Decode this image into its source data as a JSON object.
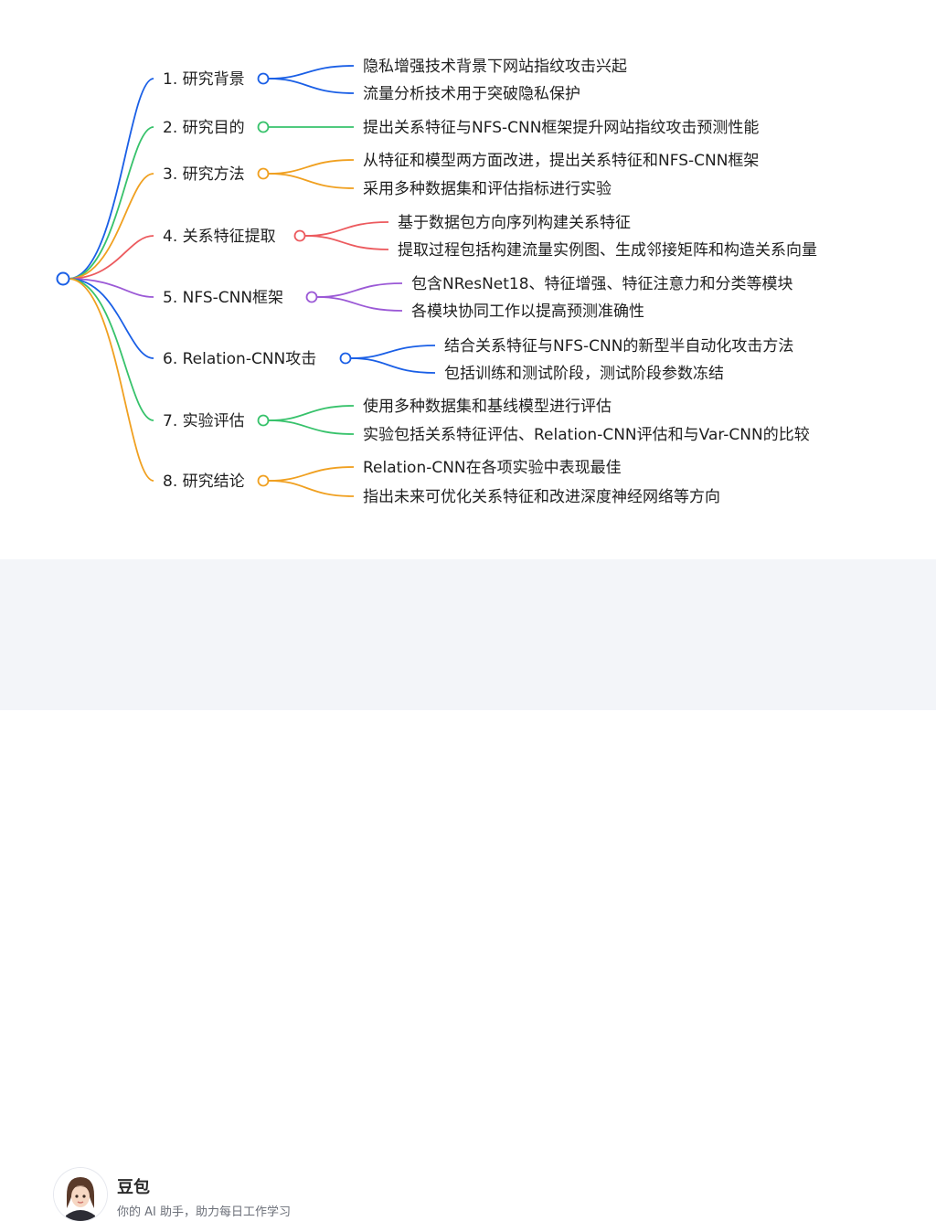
{
  "mindmap": {
    "branches": [
      {
        "label": "1. 研究背景",
        "color": "#1a5fe6",
        "children": [
          "隐私增强技术背景下网站指纹攻击兴起",
          "流量分析技术用于突破隐私保护"
        ]
      },
      {
        "label": "2. 研究目的",
        "color": "#37c26b",
        "children": [
          "提出关系特征与NFS-CNN框架提升网站指纹攻击预测性能"
        ]
      },
      {
        "label": "3. 研究方法",
        "color": "#f0a020",
        "children": [
          "从特征和模型两方面改进，提出关系特征和NFS-CNN框架",
          "采用多种数据集和评估指标进行实验"
        ]
      },
      {
        "label": "4. 关系特征提取",
        "color": "#ec5a5e",
        "children": [
          "基于数据包方向序列构建关系特征",
          "提取过程包括构建流量实例图、生成邻接矩阵和构造关系向量"
        ]
      },
      {
        "label": "5. NFS-CNN框架",
        "color": "#9b59d6",
        "children": [
          "包含NResNet18、特征增强、特征注意力和分类等模块",
          "各模块协同工作以提高预测准确性"
        ]
      },
      {
        "label": "6. Relation-CNN攻击",
        "color": "#1a5fe6",
        "children": [
          "结合关系特征与NFS-CNN的新型半自动化攻击方法",
          "包括训练和测试阶段，测试阶段参数冻结"
        ]
      },
      {
        "label": "7. 实验评估",
        "color": "#37c26b",
        "children": [
          "使用多种数据集和基线模型进行评估",
          "实验包括关系特征评估、Relation-CNN评估和与Var-CNN的比较"
        ]
      },
      {
        "label": "8. 研究结论",
        "color": "#f0a020",
        "children": [
          "Relation-CNN在各项实验中表现最佳",
          "指出未来可优化关系特征和改进深度神经网络等方向"
        ]
      }
    ]
  },
  "footer": {
    "brand": "豆包",
    "tagline": "你的 AI 助手，助力每日工作学习"
  }
}
